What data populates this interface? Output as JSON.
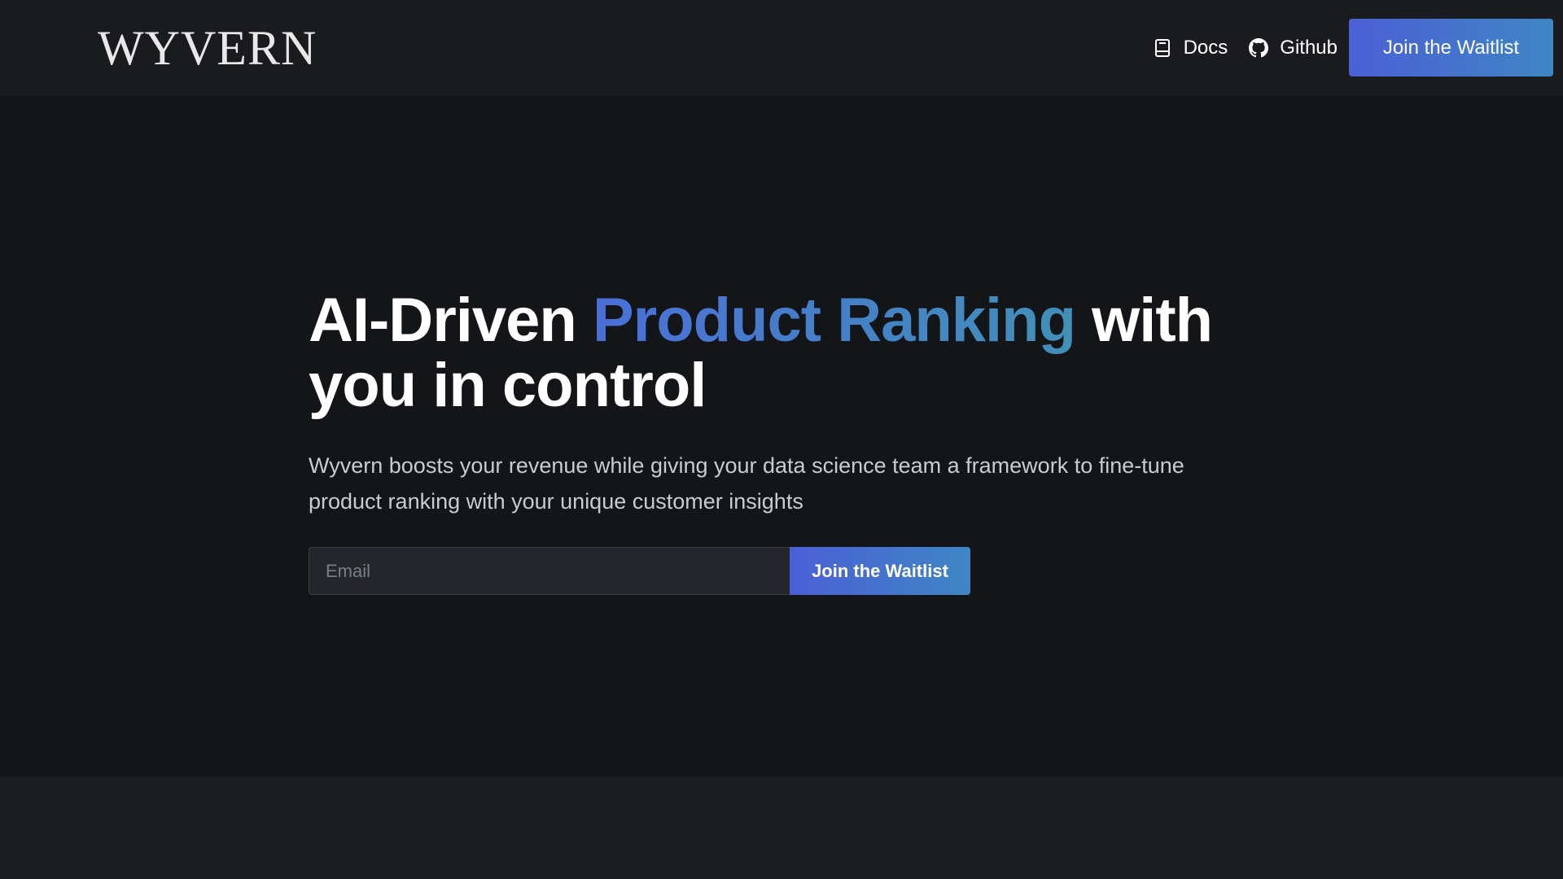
{
  "header": {
    "logo": "WYVERN",
    "nav": {
      "docs": {
        "label": "Docs",
        "icon": "book-icon"
      },
      "github": {
        "label": "Github",
        "icon": "github-icon"
      }
    },
    "cta_label": "Join the Waitlist"
  },
  "hero": {
    "headline_pre": "AI-Driven ",
    "headline_accent": "Product Ranking",
    "headline_post": " with you in control",
    "subline": "Wyvern boosts your revenue while giving your data science team a framework to fine-tune product ranking with your unique customer insights",
    "email_placeholder": "Email",
    "submit_label": "Join the Waitlist"
  },
  "colors": {
    "accent_start": "#4b5fd6",
    "accent_end": "#3f86c4",
    "background": "#131518"
  }
}
